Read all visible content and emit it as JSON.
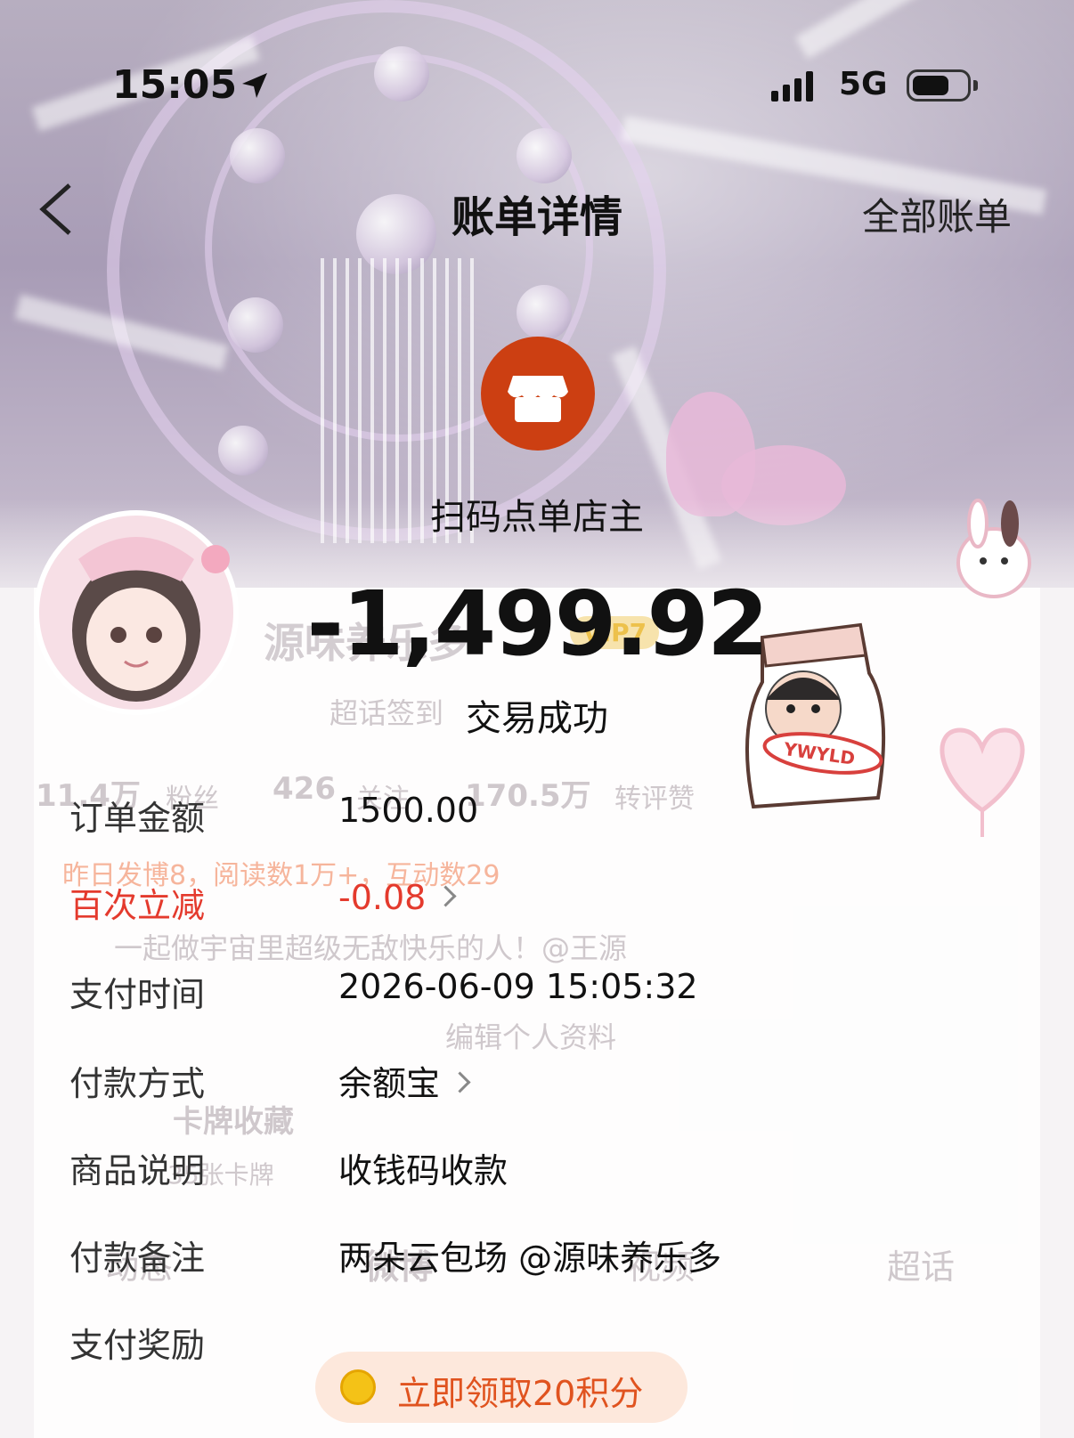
{
  "status_bar": {
    "time": "15:05",
    "network": "5G"
  },
  "nav": {
    "title": "账单详情",
    "right_link": "全部账单"
  },
  "merchant": {
    "name": "扫码点单店主",
    "amount": "-1,499.92",
    "status": "交易成功"
  },
  "details": [
    {
      "label": "订单金额",
      "value": "1500.00"
    },
    {
      "label": "百次立减",
      "value": "-0.08"
    },
    {
      "label": "支付时间",
      "value": "2026-06-09 15:05:32"
    },
    {
      "label": "付款方式",
      "value": "余额宝"
    },
    {
      "label": "商品说明",
      "value": "收钱码收款"
    },
    {
      "label": "付款备注",
      "value": "两朵云包场 @源味养乐多"
    },
    {
      "label": "支付奖励",
      "value": "立即领取20积分"
    }
  ],
  "background_profile": {
    "name": "源味养乐多",
    "vip": "VIP7",
    "checkin": "超话签到",
    "fans_count": "11.4万",
    "fans_label": "粉丝",
    "follow_count": "426",
    "follow_label": "关注",
    "likes_count": "170.5万",
    "likes_label": "转评赞",
    "stats_line": "昨日发博8，阅读数1万+，互动数29",
    "bio": "一起做宇宙里超级无敌快乐的人！@王源",
    "edit_profile": "编辑个人资料",
    "cards_title": "卡牌收藏",
    "cards_count": "35张卡牌",
    "tabs": [
      "动态",
      "微博",
      "视频",
      "超话"
    ],
    "sticker_text": "YWYLD"
  },
  "colors": {
    "merchant_logo": "#cc3f12",
    "discount_red": "#e43a2d",
    "reward_orange": "#e0531f",
    "reward_bg": "#fde8dc"
  }
}
